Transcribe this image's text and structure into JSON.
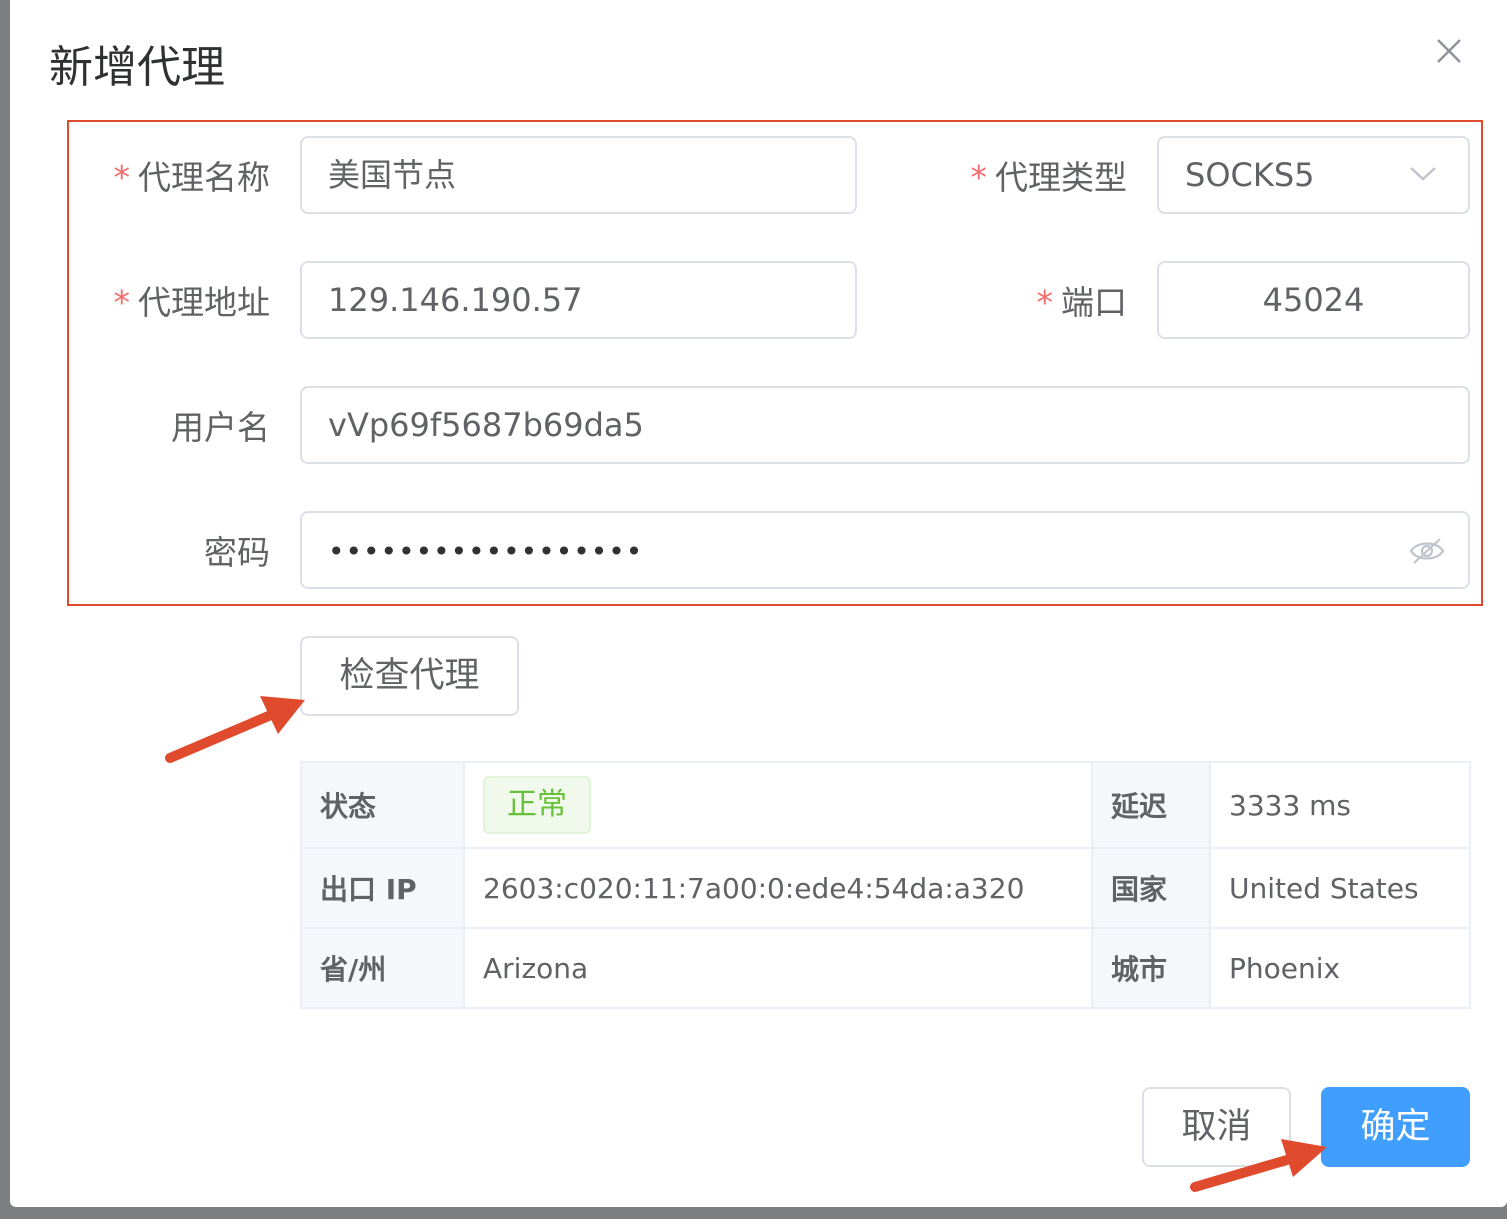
{
  "dialog": {
    "title": "新增代理"
  },
  "form": {
    "name": {
      "label": "代理名称",
      "value": "美国节点"
    },
    "type": {
      "label": "代理类型",
      "value": "SOCKS5"
    },
    "address": {
      "label": "代理地址",
      "value": "129.146.190.57"
    },
    "port": {
      "label": "端口",
      "value": "45024"
    },
    "username": {
      "label": "用户名",
      "value": "vVp69f5687b69da5"
    },
    "password": {
      "label": "密码",
      "value": "••••••••••••••••••"
    },
    "required_mark": "*"
  },
  "check_button": "检查代理",
  "result": {
    "status_label": "状态",
    "status_value": "正常",
    "latency_label": "延迟",
    "latency_value": "3333 ms",
    "ip_label": "出口 IP",
    "ip_value": "2603:c020:11:7a00:0:ede4:54da:a320",
    "country_label": "国家",
    "country_value": "United States",
    "province_label": "省/州",
    "province_value": "Arizona",
    "city_label": "城市",
    "city_value": "Phoenix"
  },
  "footer": {
    "cancel": "取消",
    "confirm": "确定"
  },
  "colors": {
    "primary": "#409eff",
    "highlight": "#e04b2e",
    "success": "#67c23a",
    "required": "#f56c6c"
  }
}
